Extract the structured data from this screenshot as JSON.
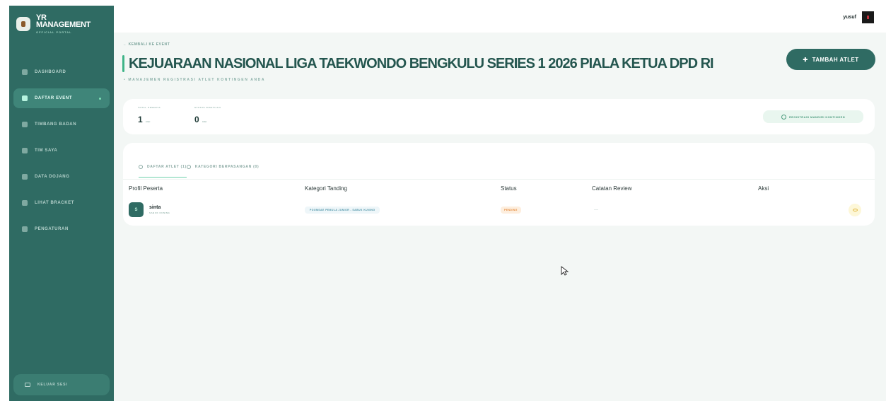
{
  "brand": {
    "title_line1": "YR",
    "title_line2": "MANAGEMENT",
    "subtitle": "OFFICIAL PORTAL"
  },
  "sidebar": {
    "items": [
      {
        "label": "DASHBOARD",
        "icon": "home-icon"
      },
      {
        "label": "DAFTAR EVENT",
        "icon": "calendar-icon",
        "active": true
      },
      {
        "label": "TIMBANG BADAN",
        "icon": "scale-icon"
      },
      {
        "label": "TIM SAYA",
        "icon": "users-icon"
      },
      {
        "label": "DATA DOJANG",
        "icon": "building-icon"
      },
      {
        "label": "LIHAT BRACKET",
        "icon": "bracket-icon"
      },
      {
        "label": "PENGATURAN",
        "icon": "gear-icon"
      }
    ],
    "logout_label": "KELUAR SESI"
  },
  "topbar": {
    "username": "yusuf"
  },
  "header": {
    "back_label": "KEMBALI KE EVENT",
    "title": "KEJUARAAN NASIONAL LIGA TAEKWONDO BENGKULU SERIES 1 2026 PIALA KETUA DPD RI",
    "subtitle": "MANAJEMEN REGISTRASI ATLET KONTINGEN ANDA",
    "add_button": "TAMBAH ATLET"
  },
  "stats": {
    "total_label": "TOTAL PESERTA",
    "total_value": "1",
    "total_unit": "Atlet",
    "approved_label": "STATUS DISETUJUI",
    "approved_value": "0",
    "approved_unit": "Atlet",
    "register_button": "REGISTRASI MANDIRI KONTINGEN"
  },
  "tabs": [
    {
      "label": "DAFTAR ATLET (1)",
      "active": true
    },
    {
      "label": "KATEGORI BERPASANGAN (0)",
      "active": false
    }
  ],
  "table": {
    "columns": [
      "Profil Peserta",
      "Kategori Tanding",
      "Status",
      "Catatan Review",
      "Aksi"
    ],
    "rows": [
      {
        "initial": "S",
        "name": "sinta",
        "belt": "SABUK KUNING",
        "category": "POOMSAE PEMULA JUNIOR - SABUK KUNING",
        "status": "PENDING",
        "review": "—"
      }
    ]
  },
  "colors": {
    "sidebar": "#2f6b63",
    "accent": "#3fb488",
    "pending": "#e58a3b"
  }
}
